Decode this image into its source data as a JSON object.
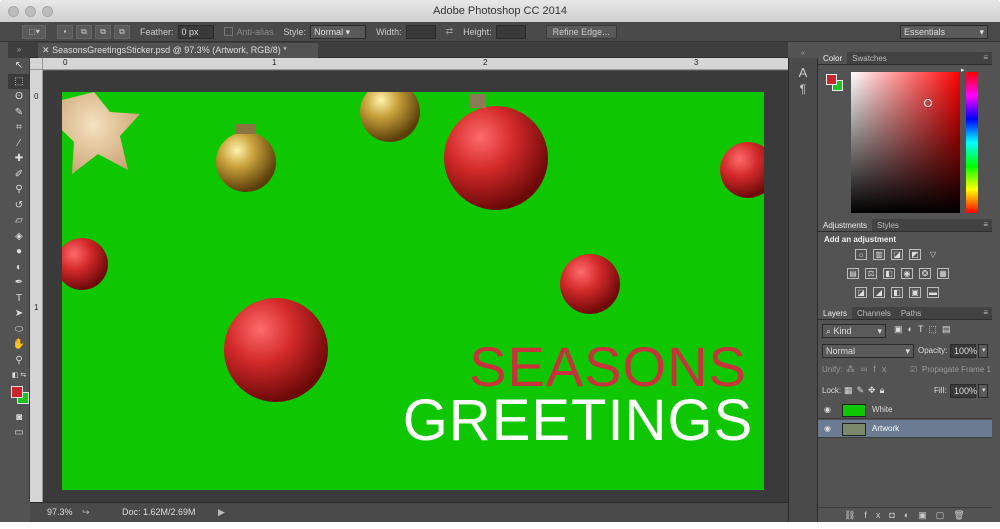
{
  "app": {
    "title": "Adobe Photoshop CC 2014"
  },
  "options": {
    "feather_label": "Feather:",
    "feather_value": "0 px",
    "antialias_label": "Anti-alias",
    "style_label": "Style:",
    "style_value": "Normal",
    "width_label": "Width:",
    "height_label": "Height:",
    "refine_label": "Refine Edge...",
    "workspace": "Essentials"
  },
  "document": {
    "tab_label": "SeasonsGreetingsSticker.psd @ 97.3% (Artwork, RGB/8) *"
  },
  "rulers": {
    "h": [
      "0",
      "1",
      "2",
      "3"
    ],
    "v": [
      "0",
      "1"
    ]
  },
  "canvas": {
    "line1": "SEASONS",
    "line2": "GREETINGS",
    "bg": "#0fc700",
    "seasons_color": "#c8323c",
    "greetings_color": "#ffffff"
  },
  "status": {
    "zoom": "97.3%",
    "doc": "Doc: 1.62M/2.69M"
  },
  "color_panel": {
    "tab_color": "Color",
    "tab_swatches": "Swatches",
    "fg": "#c9262b",
    "bg": "#1fc31f"
  },
  "adjustments": {
    "tab_adjustments": "Adjustments",
    "tab_styles": "Styles",
    "heading": "Add an adjustment"
  },
  "layers": {
    "tab_layers": "Layers",
    "tab_channels": "Channels",
    "tab_paths": "Paths",
    "kind": "Kind",
    "blend": "Normal",
    "opacity_label": "Opacity:",
    "opacity": "100%",
    "unify_label": "Unify:",
    "propagate": "Propagate Frame 1",
    "lock_label": "Lock:",
    "fill_label": "Fill:",
    "fill": "100%",
    "items": [
      {
        "name": "White"
      },
      {
        "name": "Artwork"
      }
    ]
  }
}
